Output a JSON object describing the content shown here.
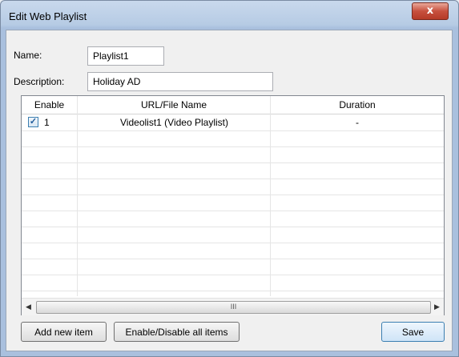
{
  "window": {
    "title": "Edit Web Playlist",
    "close_glyph": "x"
  },
  "form": {
    "name_label": "Name:",
    "name_value": "Playlist1",
    "description_label": "Description:",
    "description_value": "Holiday AD"
  },
  "table": {
    "columns": [
      "Enable",
      "URL/File Name",
      "Duration"
    ],
    "rows": [
      {
        "checked": true,
        "index": "1",
        "url": "Videolist1 (Video Playlist)",
        "duration": "-"
      }
    ],
    "scroll_thumb_glyph": "III",
    "scroll_left_glyph": "◀",
    "scroll_right_glyph": "▶"
  },
  "buttons": {
    "add_label": "Add new item",
    "toggle_label": "Enable/Disable all items",
    "save_label": "Save"
  }
}
